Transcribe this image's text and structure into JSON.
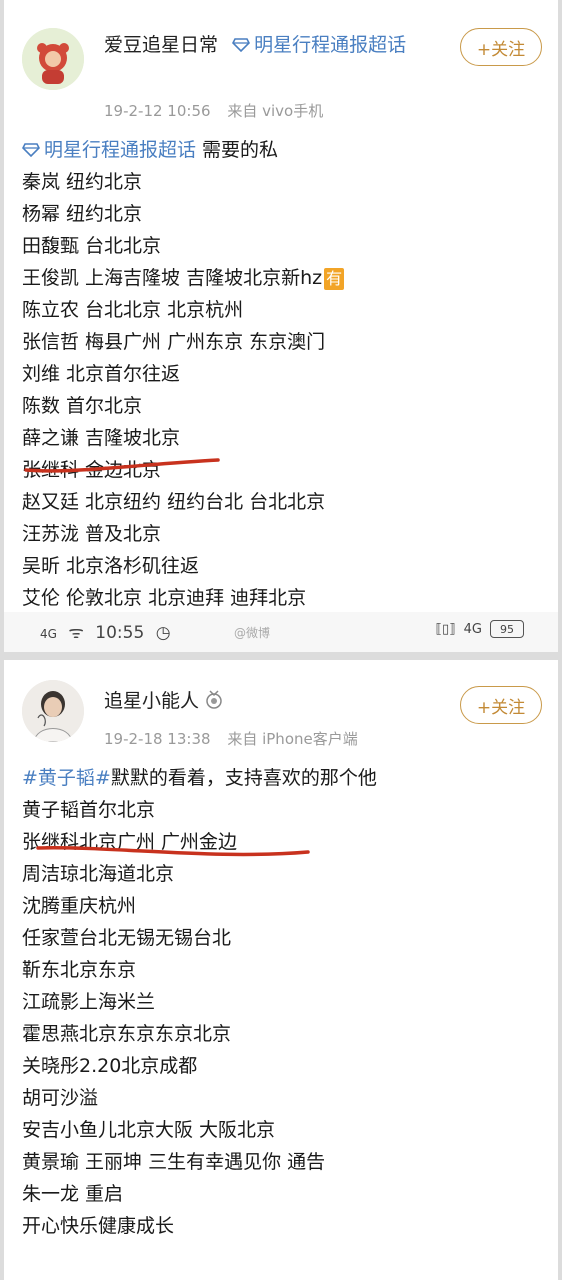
{
  "post1": {
    "username": "爱豆追星日常",
    "super_topic": "明星行程通报超话",
    "follow_label": "+关注",
    "timestamp": "19-2-12 10:56",
    "source": "来自 vivo手机",
    "topic_link": "明星行程通报超话",
    "intro": " 需要的私",
    "lines": [
      "秦岚 纽约北京",
      "杨幂 纽约北京",
      "田馥甄 台北北京",
      "王俊凯 上海吉隆坡 吉隆坡北京新hz",
      "陈立农 台北北京 北京杭州",
      "张信哲 梅县广州 广州东京 东京澳门",
      "刘维 北京首尔往返",
      "陈数 首尔北京",
      "薛之谦 吉隆坡北京",
      "张继科 金边北京",
      "赵又廷 北京纽约 纽约台北 台北北京",
      "汪苏泷 普及北京",
      "吴昕 北京洛杉矶往返",
      "艾伦 伦敦北京 北京迪拜 迪拜北京"
    ],
    "you_tag": "有",
    "status": {
      "signal": "4G",
      "time": "10:55",
      "battery": "95",
      "watermark": "@微博"
    }
  },
  "post2": {
    "username": "追星小能人",
    "follow_label": "+关注",
    "timestamp": "19-2-18 13:38",
    "source": "来自 iPhone客户端",
    "topic": "#黄子韬#",
    "intro": "默默的看着，支持喜欢的那个他",
    "lines": [
      "黄子韬首尔北京",
      "张继科北京广州 广州金边",
      "周洁琼北海道北京",
      "沈腾重庆杭州",
      "任家萱台北无锡无锡台北",
      "靳东北京东京",
      "江疏影上海米兰",
      "霍思燕北京东京东京北京",
      "关晓彤2.20北京成都",
      "胡可沙溢",
      "安吉小鱼儿北京大阪 大阪北京",
      "黄景瑜 王丽坤 三生有幸遇见你 通告",
      "朱一龙 重启",
      "开心快乐健康成长"
    ]
  },
  "colors": {
    "link": "#4a7fc1",
    "follow": "#c38a36",
    "underline": "#c8321e",
    "tag": "#f2a427"
  }
}
